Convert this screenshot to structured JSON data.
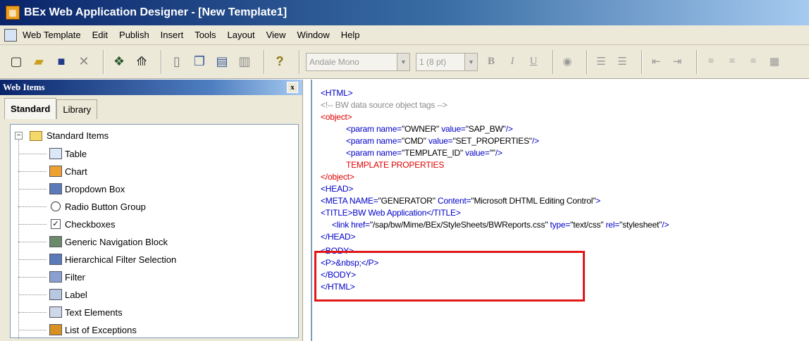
{
  "window": {
    "title": "BEx Web Application Designer - [New Template1]"
  },
  "menu": [
    "Web Template",
    "Edit",
    "Publish",
    "Insert",
    "Tools",
    "Layout",
    "View",
    "Window",
    "Help"
  ],
  "toolbar": {
    "font_name": "Andale Mono",
    "font_size": "1 (8 pt)",
    "bold": "B",
    "italic": "I",
    "underline": "U"
  },
  "panel": {
    "title": "Web Items",
    "close": "x",
    "tabs": [
      "Standard",
      "Library"
    ],
    "root": "Standard Items",
    "items": [
      "Table",
      "Chart",
      "Dropdown Box",
      "Radio Button Group",
      "Checkboxes",
      "Generic Navigation Block",
      "Hierarchical Filter Selection",
      "Filter",
      "Label",
      "Text Elements",
      "List of Exceptions"
    ]
  },
  "code": {
    "html_open": "<HTML>",
    "comment": "<!-- BW data source object tags -->",
    "object_open": "<object>",
    "param1": {
      "tag": "<param name=",
      "name": "\"OWNER\"",
      "mid": " value=",
      "value": "\"SAP_BW\"",
      "end": "/>"
    },
    "param2": {
      "tag": "<param name=",
      "name": "\"CMD\"",
      "mid": " value=",
      "value": "\"SET_PROPERTIES\"",
      "end": "/>"
    },
    "param3": {
      "tag": "<param name=",
      "name": "\"TEMPLATE_ID\"",
      "mid": " value=",
      "value": "\"\"",
      "end": "/>"
    },
    "template_props": "TEMPLATE PROPERTIES",
    "object_close": "</object>",
    "head_open": "<HEAD>",
    "meta": {
      "tag": "<META NAME=",
      "name": "\"GENERATOR\"",
      "mid": " Content=",
      "value": "\"Microsoft DHTML Editing Control\"",
      "end": ">"
    },
    "title": {
      "open": "<TITLE>",
      "text": "BW Web Application",
      "close": "</TITLE>"
    },
    "link": {
      "tag": "<link href=",
      "href": "\"/sap/bw/Mime/BEx/StyleSheets/BWReports.css\"",
      "t1": " type=",
      "type": "\"text/css\"",
      "t2": " rel=",
      "rel": "\"stylesheet\"",
      "end": "/>"
    },
    "head_close": "</HEAD>",
    "body_open": "<BODY>",
    "p_line": {
      "open": "<P>",
      "text": "&nbsp;",
      "close": "</P>"
    },
    "body_close": "</BODY>",
    "html_close": "</HTML>"
  },
  "colors": {
    "tag": "#0000c8",
    "red": "#e00000",
    "highlight": "#e01818"
  }
}
